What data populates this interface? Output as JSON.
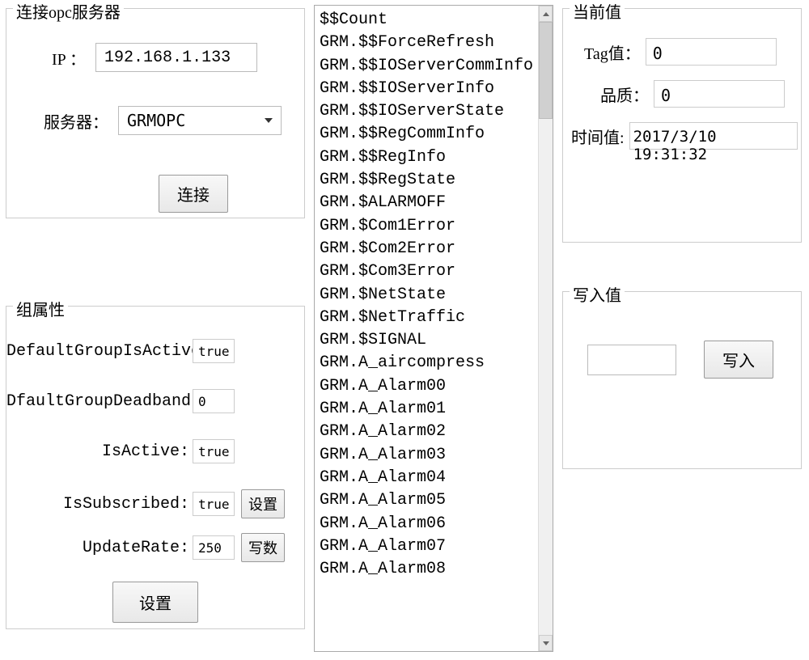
{
  "connect": {
    "title": "连接opc服务器",
    "ip_label": "IP ：",
    "ip_value": "192.168.1.133",
    "server_label": "服务器：",
    "server_value": "GRMOPC",
    "connect_btn": "连接"
  },
  "group": {
    "title": "组属性",
    "rows": [
      {
        "label": "DefaultGroupIsActive:",
        "value": "true"
      },
      {
        "label": "DfaultGroupDeadband:",
        "value": "0"
      },
      {
        "label": "IsActive:",
        "value": "true"
      },
      {
        "label": "IsSubscribed:",
        "value": "true"
      },
      {
        "label": "UpdateRate:",
        "value": "250"
      }
    ],
    "set_btn": "设置",
    "write_num_btn": "写数",
    "settings_btn": "设置"
  },
  "list": {
    "items": [
      "$$Count",
      "GRM.$$ForceRefresh",
      "GRM.$$IOServerCommInfo",
      "GRM.$$IOServerInfo",
      "GRM.$$IOServerState",
      "GRM.$$RegCommInfo",
      "GRM.$$RegInfo",
      "GRM.$$RegState",
      "GRM.$ALARMOFF",
      "GRM.$Com1Error",
      "GRM.$Com2Error",
      "GRM.$Com3Error",
      "GRM.$NetState",
      "GRM.$NetTraffic",
      "GRM.$SIGNAL",
      "GRM.A_aircompress",
      "GRM.A_Alarm00",
      "GRM.A_Alarm01",
      "GRM.A_Alarm02",
      "GRM.A_Alarm03",
      "GRM.A_Alarm04",
      "GRM.A_Alarm05",
      "GRM.A_Alarm06",
      "GRM.A_Alarm07",
      "GRM.A_Alarm08"
    ]
  },
  "current": {
    "title": "当前值",
    "tag_label": "Tag值：",
    "tag_value": "0",
    "quality_label": "品质：",
    "quality_value": "0",
    "time_label": "时间值:",
    "time_value": "2017/3/10 19:31:32"
  },
  "write": {
    "title": "写入值",
    "value": "",
    "btn": "写入"
  }
}
